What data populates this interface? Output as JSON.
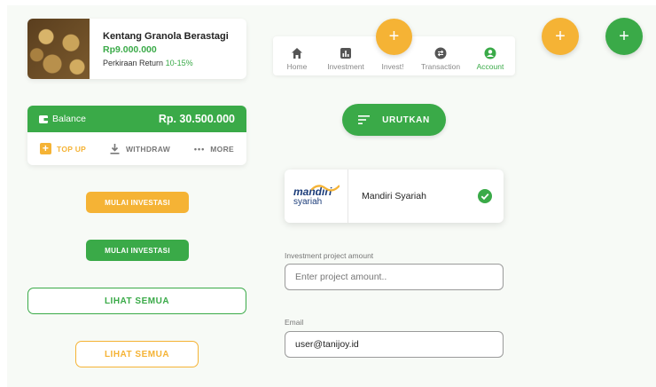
{
  "product": {
    "title": "Kentang Granola Berastagi",
    "price": "Rp9.000.000",
    "return_label": "Perkiraan Return",
    "return_value": "10-15%"
  },
  "nav": {
    "items": [
      {
        "label": "Home",
        "icon": "home-icon"
      },
      {
        "label": "Investment",
        "icon": "chart-icon"
      },
      {
        "label": "Invest!",
        "icon": "plus-icon"
      },
      {
        "label": "Transaction",
        "icon": "transfer-icon"
      },
      {
        "label": "Account",
        "icon": "user-icon"
      }
    ],
    "fab_symbol": "+"
  },
  "fabs": {
    "yellow_symbol": "+",
    "green_symbol": "+"
  },
  "balance": {
    "label": "Balance",
    "amount": "Rp. 30.500.000",
    "topup_symbol": "+",
    "topup": "TOP UP",
    "withdraw": "WITHDRAW",
    "more_dots": "•••",
    "more": "MORE"
  },
  "buttons": {
    "mulai_yellow": "MULAI INVESTASI",
    "mulai_green": "MULAI INVESTASI",
    "lihat_green": "LIHAT SEMUA",
    "lihat_yellow": "LIHAT SEMUA",
    "urutkan": "URUTKAN"
  },
  "bank": {
    "logo_main": "mandiri",
    "logo_sub": "syariah",
    "name": "Mandiri Syariah"
  },
  "form": {
    "amount_label": "Investment project amount",
    "amount_placeholder": "Enter project amount..",
    "email_label": "Email",
    "email_value": "user@tanijoy.id"
  },
  "colors": {
    "green": "#3aaa48",
    "yellow": "#f5b335",
    "navy": "#1c3d7a"
  }
}
